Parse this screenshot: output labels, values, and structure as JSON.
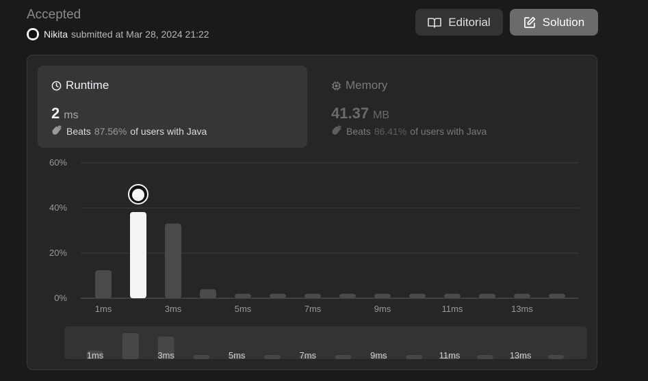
{
  "status": "Accepted",
  "submission": {
    "user": "Nikita",
    "text": "submitted at Mar 28, 2024 21:22"
  },
  "buttons": {
    "editorial": "Editorial",
    "solution": "Solution"
  },
  "runtime": {
    "title": "Runtime",
    "value": "2",
    "unit": "ms",
    "beats_label": "Beats",
    "beats_pct": "87.56%",
    "beats_suffix": "of users with Java"
  },
  "memory": {
    "title": "Memory",
    "value": "41.37",
    "unit": "MB",
    "beats_label": "Beats",
    "beats_pct": "86.41%",
    "beats_suffix": "of users with Java"
  },
  "colors": {
    "bar": "#4a4a4a",
    "bar_selected": "#f5f5f5",
    "background": "#1a1a1a",
    "card": "#262626"
  },
  "chart_data": {
    "type": "bar",
    "title": "",
    "xlabel": "",
    "ylabel": "",
    "ylim": [
      0,
      60
    ],
    "yticks": [
      "0%",
      "20%",
      "40%",
      "60%"
    ],
    "x_tick_labels": [
      "1ms",
      "3ms",
      "5ms",
      "7ms",
      "9ms",
      "11ms",
      "13ms"
    ],
    "categories": [
      "1ms",
      "2ms",
      "3ms",
      "4ms",
      "5ms",
      "6ms",
      "7ms",
      "8ms",
      "9ms",
      "10ms",
      "11ms",
      "12ms",
      "13ms",
      "14ms"
    ],
    "values": [
      12.4,
      38.2,
      33.1,
      4.0,
      2.0,
      2.0,
      2.0,
      2.0,
      2.0,
      2.0,
      2.0,
      2.0,
      2.0,
      2.0
    ],
    "selected_index": 1,
    "grid": true
  }
}
